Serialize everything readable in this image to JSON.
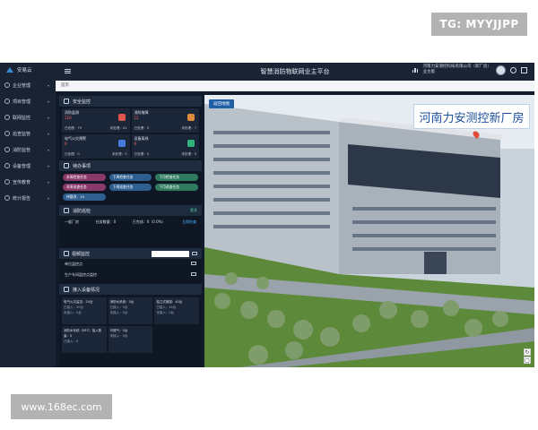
{
  "watermarks": {
    "tg": "TG: MYYJJPP",
    "site": "www.168ec.com"
  },
  "brand": {
    "name": "安易云"
  },
  "sidebar": {
    "items": [
      {
        "label": "企业管理",
        "icon": "building-icon"
      },
      {
        "label": "项目管理",
        "icon": "project-icon"
      },
      {
        "label": "联网监控",
        "icon": "monitor-icon"
      },
      {
        "label": "巡查监管",
        "icon": "inspect-icon"
      },
      {
        "label": "消防监管",
        "icon": "fire-icon"
      },
      {
        "label": "设备管理",
        "icon": "device-icon"
      },
      {
        "label": "宣传教育",
        "icon": "education-icon"
      },
      {
        "label": "统计报告",
        "icon": "report-icon"
      }
    ]
  },
  "topbar": {
    "title": "智慧消防物联网业主平台",
    "company_line1": "河南力安测控科技有限公司（新厂房）",
    "company_line2": "业主版"
  },
  "breadcrumb": {
    "tab": "首页"
  },
  "safety": {
    "title": "安全监控",
    "cards": [
      {
        "name": "消防监测",
        "count": "120",
        "left": "已处理：79",
        "right": "未处理：41",
        "color": "#e0564b"
      },
      {
        "name": "消防故障",
        "count": "12",
        "left": "已处理：5",
        "right": "未处理：7",
        "color": "#e08a3b"
      },
      {
        "name": "电气火灾预警",
        "count": "0",
        "left": "已处理：0",
        "right": "未处理：0",
        "color": "#4a7be0"
      },
      {
        "name": "设备离线",
        "count": "0",
        "left": "已处理：0",
        "right": "未处理：0",
        "color": "#2fb57a"
      }
    ]
  },
  "tasks": {
    "title": "待办事项",
    "items": [
      {
        "label": "本周检查任务",
        "color": "#8a3a6a"
      },
      {
        "label": "下周检查任务",
        "color": "#2f5f8f"
      },
      {
        "label": "下月检查任务",
        "color": "#2f7a5f"
      },
      {
        "label": "本周巡查任务",
        "color": "#8a3a6a"
      },
      {
        "label": "下周巡查任务",
        "color": "#2f5f8f"
      },
      {
        "label": "下月巡查任务",
        "color": "#2f7a5f"
      },
      {
        "label": "待整改：10",
        "color": "#2f5f8f"
      }
    ]
  },
  "fire_check": {
    "title": "消防巡检",
    "more": "更多",
    "row": {
      "name": "一般厂房",
      "tasks": "任务数量：0",
      "done": "已完成：0（0.0%）",
      "link": "立即检查"
    }
  },
  "video": {
    "title": "视频监控",
    "placeholder": "",
    "cams": [
      {
        "label": "单位监控点"
      },
      {
        "label": "生产车间监控点监控"
      }
    ]
  },
  "ports": {
    "title": "接入设备情况",
    "items": [
      {
        "name": "电气火灾监控：20台",
        "l1": "已接入：20台",
        "l2": "未接入：0台"
      },
      {
        "name": "消防水系统：0台",
        "l1": "已接入：0台",
        "l2": "未接入：0台"
      },
      {
        "name": "独立式烟感：45台",
        "l1": "已接入：45台",
        "l2": "未接入：0台"
      },
      {
        "name": "消防水系统（NFC）接入数量：0",
        "l1": "已接入：0",
        "l2": ""
      },
      {
        "name": "可燃气：0台",
        "l1": "未接入：0台",
        "l2": ""
      }
    ]
  },
  "scene": {
    "back_label": "返回地图",
    "label": "河南力安测控新厂房"
  }
}
